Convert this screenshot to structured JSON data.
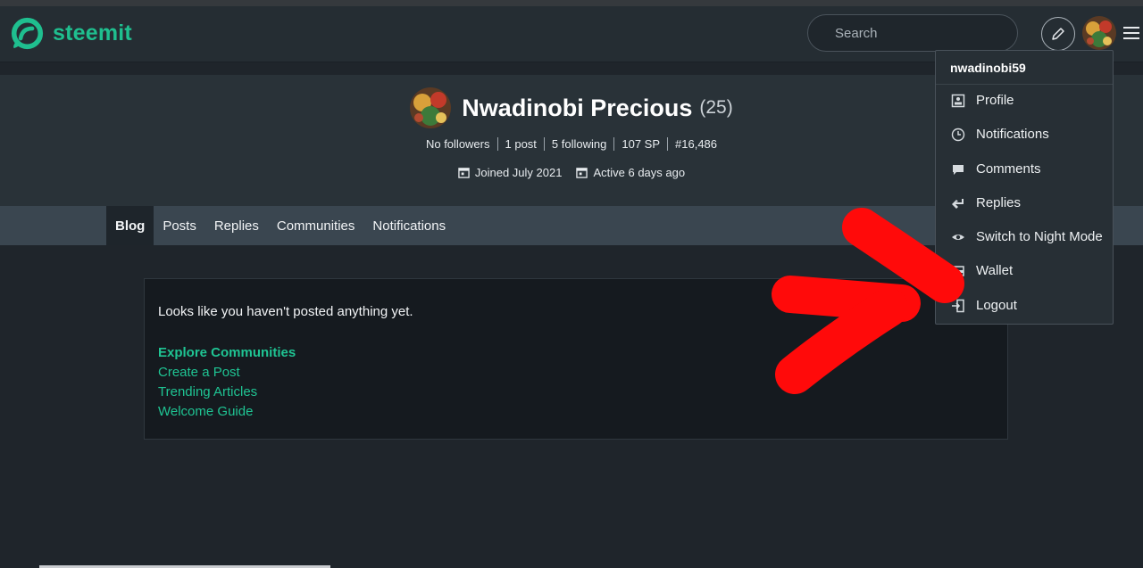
{
  "header": {
    "logo_text": "steemit",
    "search_placeholder": "Search",
    "brand_color": "#1fbf8f"
  },
  "profile": {
    "name": "Nwadinobi Precious",
    "reputation": "(25)",
    "stats": {
      "followers": "No followers",
      "posts": "1 post",
      "following": "5 following",
      "sp": "107 SP",
      "rank": "#16,486"
    },
    "joined": "Joined July 2021",
    "active": "Active 6 days ago"
  },
  "tabs": [
    {
      "label": "Blog",
      "active": true
    },
    {
      "label": "Posts"
    },
    {
      "label": "Replies"
    },
    {
      "label": "Communities"
    },
    {
      "label": "Notifications"
    }
  ],
  "content": {
    "empty_message": "Looks like you haven't posted anything yet.",
    "links": [
      "Explore Communities",
      "Create a Post",
      "Trending Articles",
      "Welcome Guide"
    ]
  },
  "dropdown": {
    "username": "nwadinobi59",
    "items": [
      {
        "label": "Profile",
        "icon": "profile-icon"
      },
      {
        "label": "Notifications",
        "icon": "clock-icon"
      },
      {
        "label": "Comments",
        "icon": "comment-icon"
      },
      {
        "label": "Replies",
        "icon": "reply-icon"
      },
      {
        "label": "Switch to Night Mode",
        "icon": "eye-icon"
      },
      {
        "label": "Wallet",
        "icon": "wallet-icon"
      },
      {
        "label": "Logout",
        "icon": "logout-icon"
      }
    ]
  },
  "annotation": {
    "color": "#ff0000",
    "shape": "red arrow pointing to Wallet"
  }
}
